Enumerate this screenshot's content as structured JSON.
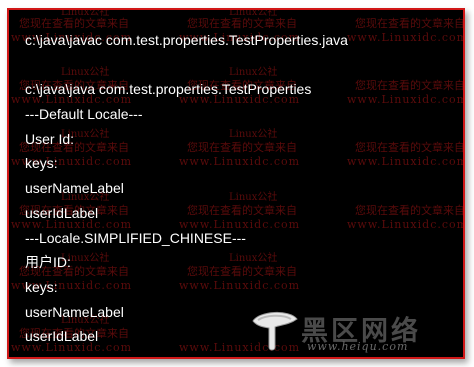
{
  "console": {
    "lines": [
      "c:\\java\\javac com.test.properties.TestProperties.java",
      "",
      "c:\\java\\java com.test.properties.TestProperties",
      "---Default Locale---",
      "User Id:",
      "keys:",
      "userNameLabel",
      "userIdLabel",
      "---Locale.SIMPLIFIED_CHINESE---",
      "用户ID:",
      "keys:",
      "userNameLabel",
      "userIdLabel"
    ]
  },
  "watermark": {
    "cn_text": "您现在查看的文章来自",
    "site_text": "www.Linuxidc.com",
    "linux_text": "Linux公社"
  },
  "logo": {
    "name": "黑区网络",
    "url": "www.heiqu.com"
  },
  "colors": {
    "background": "#000000",
    "border": "#d11818",
    "text": "#ffffff",
    "watermark": "#5a0b0b"
  }
}
